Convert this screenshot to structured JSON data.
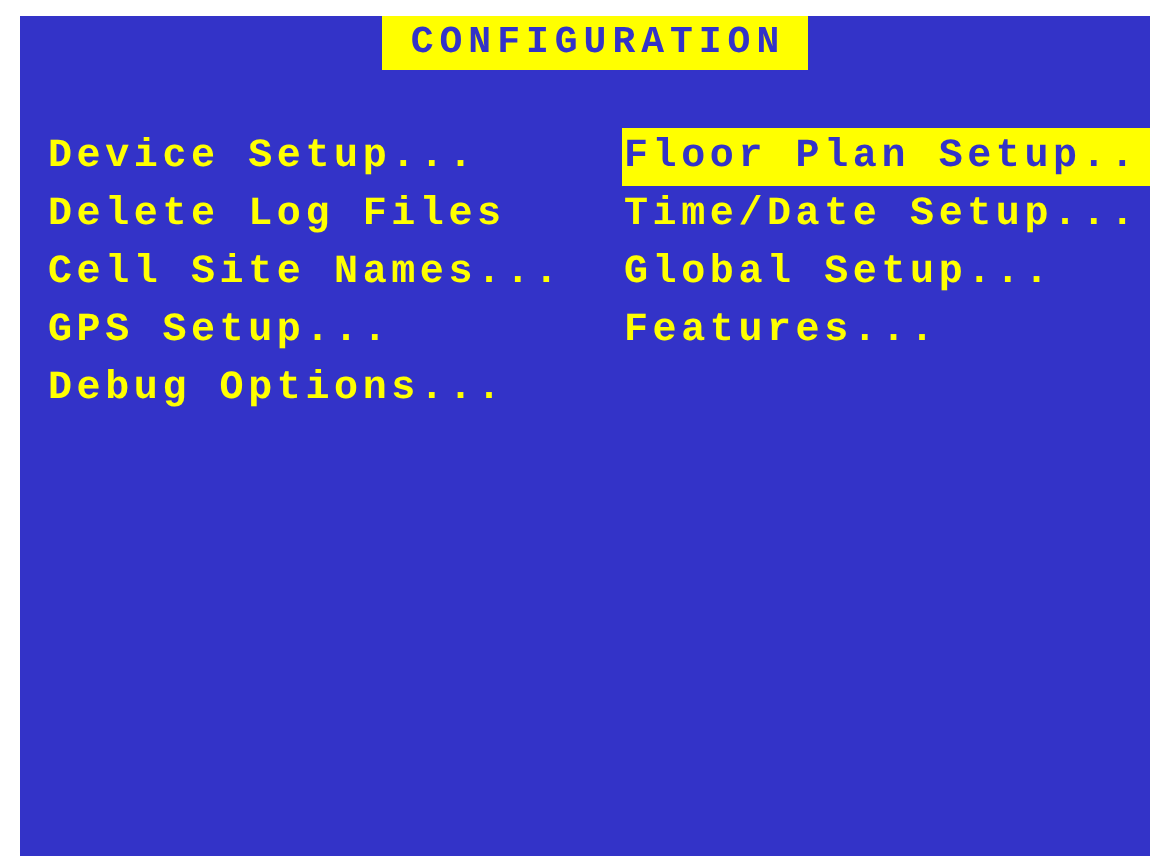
{
  "title": "CONFIGURATION",
  "columns": [
    {
      "items": [
        {
          "label": "Device Setup...",
          "selected": false
        },
        {
          "label": "Delete Log Files",
          "selected": false
        },
        {
          "label": "Cell Site Names...",
          "selected": false
        },
        {
          "label": "GPS Setup...",
          "selected": false
        },
        {
          "label": "Debug Options...",
          "selected": false
        }
      ]
    },
    {
      "items": [
        {
          "label": "Floor Plan Setup..",
          "selected": true
        },
        {
          "label": "Time/Date Setup...",
          "selected": false
        },
        {
          "label": "Global Setup...",
          "selected": false
        },
        {
          "label": "Features...",
          "selected": false
        }
      ]
    }
  ]
}
